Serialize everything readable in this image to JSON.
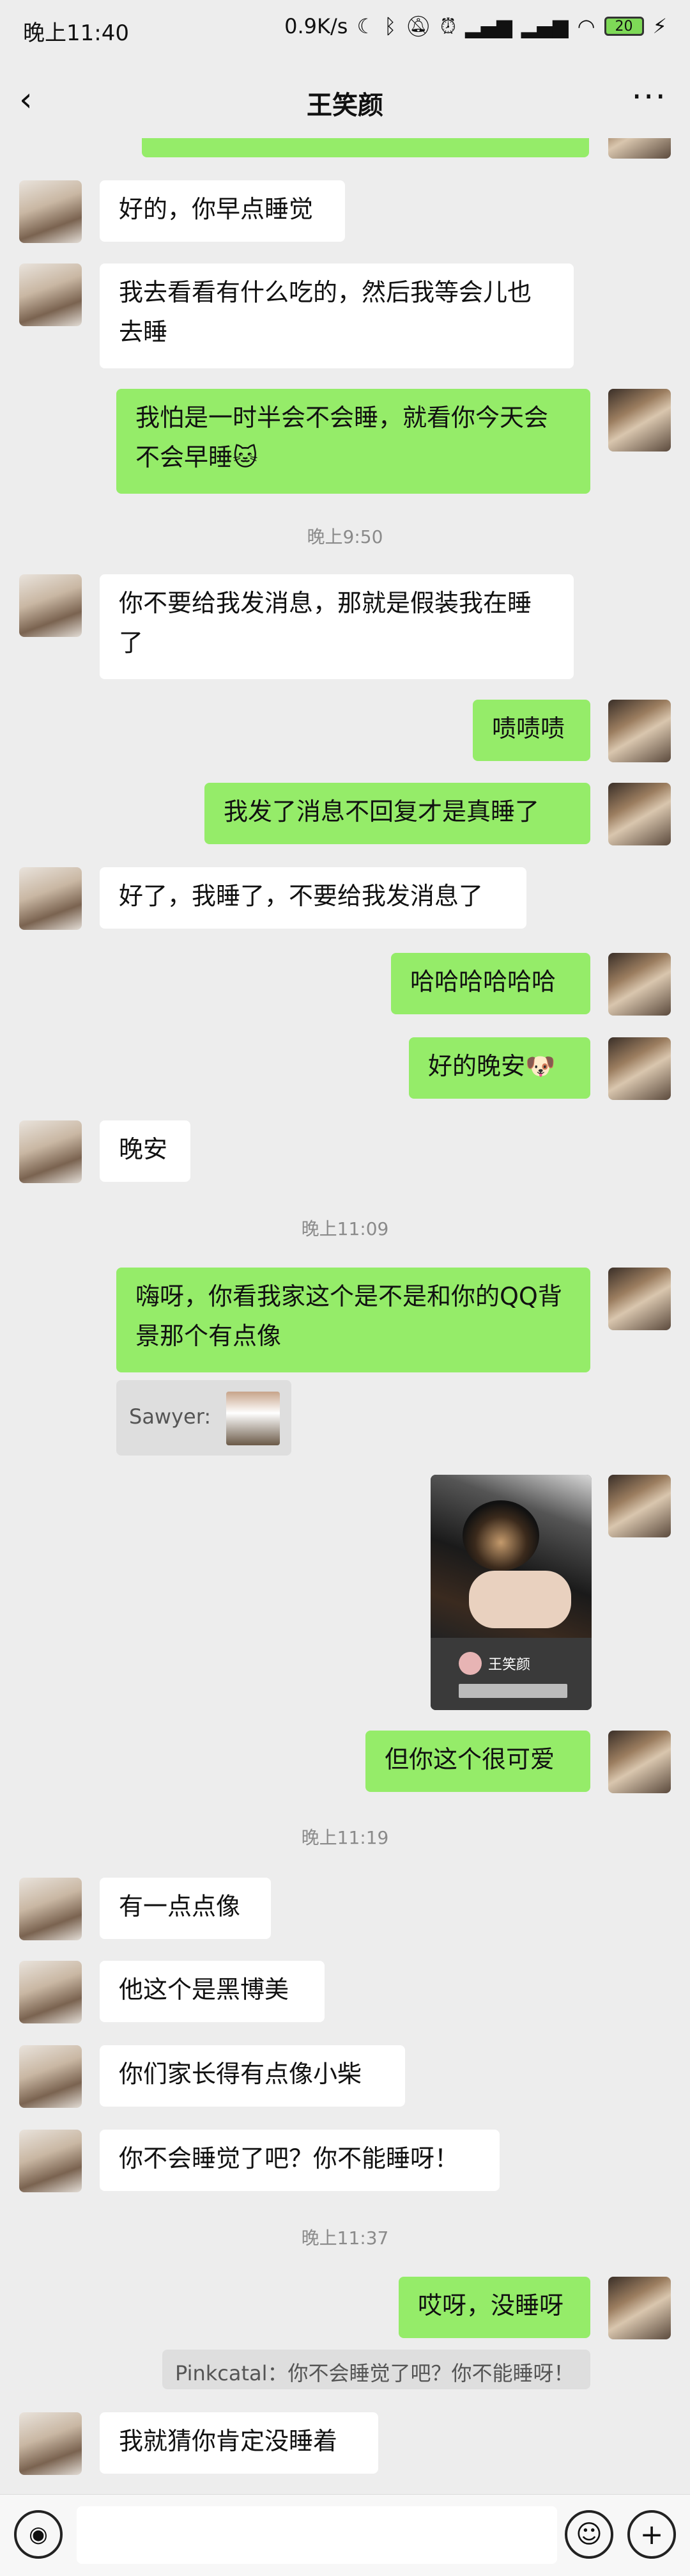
{
  "status_bar": {
    "time": "晚上11:40",
    "net_speed": "0.9K/s",
    "battery": "20",
    "icons": [
      "moon-icon",
      "bluetooth-icon",
      "mute-icon",
      "alarm-icon",
      "signal-icon",
      "signal-icon",
      "wifi-icon",
      "battery-icon",
      "charging-icon"
    ]
  },
  "header": {
    "title": "王笑颜",
    "back_icon": "chevron-left-icon",
    "more_icon": "more-icon"
  },
  "messages": [
    {
      "side": "left",
      "text": "好的，你早点睡觉"
    },
    {
      "side": "left",
      "text": "我去看看有什么吃的，然后我等会儿也去睡"
    },
    {
      "side": "right",
      "text": "我怕是一时半会不会睡，就看你今天会不会早睡🐱"
    },
    {
      "type": "time",
      "text": "晚上9:50"
    },
    {
      "side": "left",
      "text": "你不要给我发消息，那就是假装我在睡了"
    },
    {
      "side": "right",
      "text": "啧啧啧"
    },
    {
      "side": "right",
      "text": "我发了消息不回复才是真睡了"
    },
    {
      "side": "left",
      "text": "好了，我睡了，不要给我发消息了"
    },
    {
      "side": "right",
      "text": "哈哈哈哈哈哈"
    },
    {
      "side": "right",
      "text": "好的晚安🐶"
    },
    {
      "side": "left",
      "text": "晚安"
    },
    {
      "type": "time",
      "text": "晚上11:09"
    },
    {
      "side": "right",
      "text": "嗨呀，你看我家这个是不是和你的QQ背景那个有点像"
    },
    {
      "type": "quote",
      "text": "Sawyer:"
    },
    {
      "type": "image",
      "caption": "王笑颜"
    },
    {
      "side": "right",
      "text": "但你这个很可爱"
    },
    {
      "type": "time",
      "text": "晚上11:19"
    },
    {
      "side": "left",
      "text": "有一点点像"
    },
    {
      "side": "left",
      "text": "他这个是黑博美"
    },
    {
      "side": "left",
      "text": "你们家长得有点像小柴"
    },
    {
      "side": "left",
      "text": "你不会睡觉了吧？你不能睡呀！"
    },
    {
      "type": "time",
      "text": "晚上11:37"
    },
    {
      "side": "right",
      "text": "哎呀，没睡呀"
    },
    {
      "type": "quote",
      "text": "Pinkcatal：你不会睡觉了吧？你不能睡呀！"
    },
    {
      "side": "left",
      "text": "我就猜你肯定没睡着"
    }
  ],
  "input_bar": {
    "voice_icon": "voice-icon",
    "emoji_icon": "emoji-icon",
    "plus_icon": "plus-icon"
  }
}
